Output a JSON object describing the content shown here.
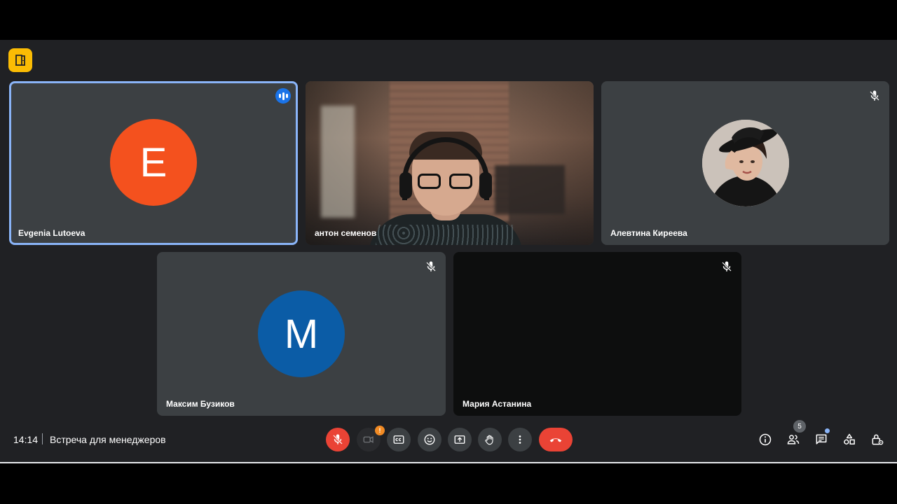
{
  "meeting": {
    "time": "14:14",
    "title": "Встреча для менеджеров",
    "participant_count": "5"
  },
  "participants": [
    {
      "name": "Evgenia Lutoeva",
      "initial": "E",
      "color": "#f4511e",
      "state": "speaking"
    },
    {
      "name": "антон семенов",
      "state": "video"
    },
    {
      "name": "Алевтина Киреева",
      "state": "muted-photo"
    },
    {
      "name": "Максим Бузиков",
      "initial": "M",
      "color": "#0b5ca6",
      "state": "muted"
    },
    {
      "name": "Мария Астанина",
      "state": "muted-dark"
    }
  ],
  "controls": {
    "mic": "mic-off-icon",
    "camera": "camera-off-icon",
    "camera_warning": "!",
    "captions": "cc-icon",
    "emoji": "emoji-icon",
    "present": "present-icon",
    "raise_hand": "hand-icon",
    "more": "more-vert-icon",
    "end_call": "call-end-icon"
  },
  "side_panel": [
    "info-icon",
    "people-icon",
    "chat-icon",
    "activities-icon",
    "host-controls-icon"
  ],
  "colors": {
    "background": "#202124",
    "tile": "#3c4043",
    "accent_red": "#ea4335",
    "accent_blue": "#8ab4f8",
    "badge_yellow": "#fbbc04"
  }
}
